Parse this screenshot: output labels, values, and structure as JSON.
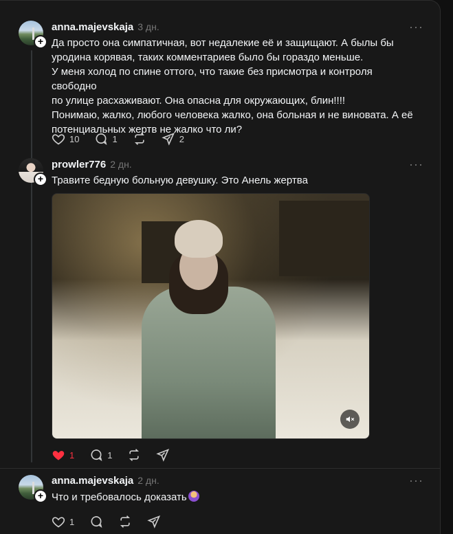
{
  "posts": [
    {
      "username": "anna.majevskaja",
      "time": "3 дн.",
      "text_lines": [
        "Да просто она симпатичная, вот недалекие её и защищают. А былы бы",
        "уродина корявая, таких комментариев было бы гораздо меньше.",
        "У меня холод по спине оттого, что такие без присмотра и контроля свободно",
        "по улице расхаживают. Она опасна для окружающих, блин!!!!",
        "Понимаю, жалко, любого человека жалко, она больная и не виновата. А её",
        "потенциальных жертв не жалко что ли?"
      ],
      "likes": "10",
      "replies": "1",
      "reposts": "",
      "shares": "2"
    },
    {
      "username": "prowler776",
      "time": "2 дн.",
      "text": "Травите бедную больную девушку. Это Анель жертва",
      "likes": "1",
      "replies": "1",
      "reposts": "",
      "shares": ""
    },
    {
      "username": "anna.majevskaja",
      "time": "2 дн.",
      "text": "Что и требовалось доказать",
      "likes": "1",
      "replies": "",
      "reposts": "",
      "shares": ""
    }
  ],
  "icons": {
    "more": "more-icon",
    "like": "heart-icon",
    "reply": "comment-icon",
    "repost": "repost-icon",
    "share": "share-icon",
    "mute": "mute-icon"
  },
  "colors": {
    "background": "#181818",
    "text": "#f3f5f7",
    "muted": "#777777",
    "like_active": "#ff3040"
  }
}
